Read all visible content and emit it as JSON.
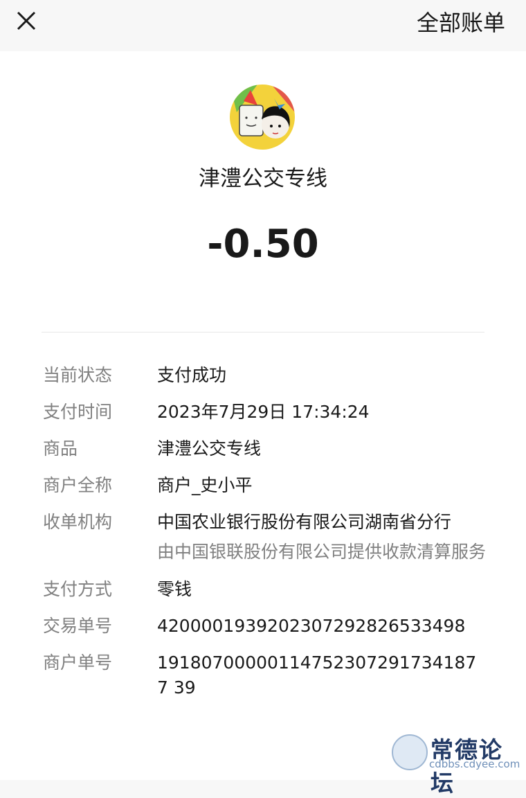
{
  "header": {
    "right_label": "全部账单",
    "close_icon": "close-icon"
  },
  "bill": {
    "avatar": "merchant-avatar",
    "merchant_name": "津澧公交专线",
    "amount": "-0.50"
  },
  "details": {
    "status_label": "当前状态",
    "status_value": "支付成功",
    "time_label": "支付时间",
    "time_value": "2023年7月29日 17:34:24",
    "goods_label": "商品",
    "goods_value": "津澧公交专线",
    "merchant_full_label": "商户全称",
    "merchant_full_value": "商户_史小平",
    "acquirer_label": "收单机构",
    "acquirer_value": "中国农业银行股份有限公司湖南省分行",
    "acquirer_note": "由中国银联股份有限公司提供收款清算服务",
    "method_label": "支付方式",
    "method_value": "零钱",
    "transaction_label": "交易单号",
    "transaction_value": "4200001939202307292826533498",
    "merchant_order_label": "商户单号",
    "merchant_order_value": "191807000001147523072917341877 39"
  },
  "watermark": {
    "title": "常德论坛",
    "url": "cdbbs.cdyee.com"
  }
}
